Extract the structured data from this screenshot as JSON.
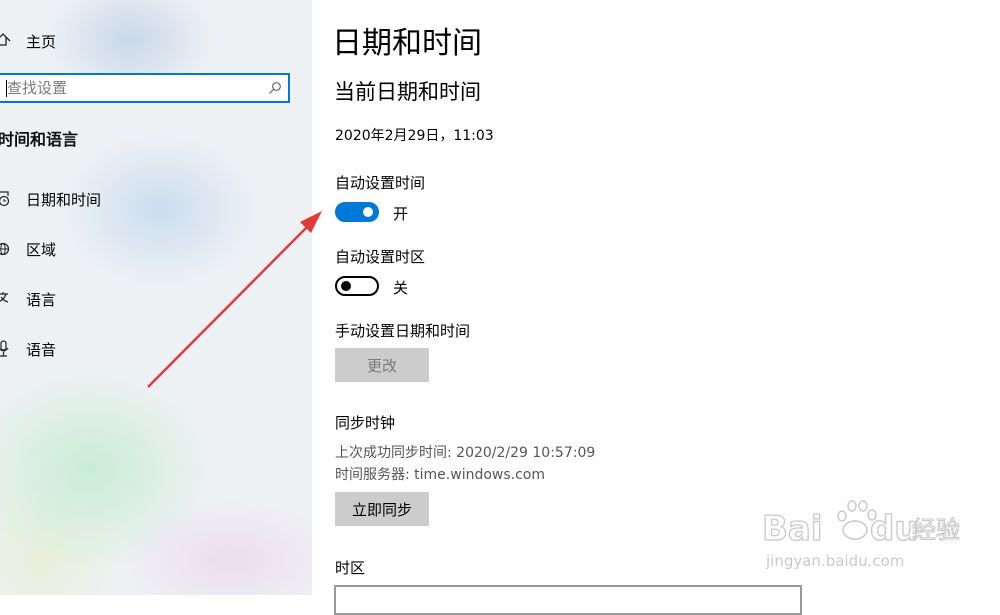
{
  "sidebar": {
    "home_label": "主页",
    "search_placeholder": "查找设置",
    "section_title": "时间和语言",
    "items": [
      {
        "label": "日期和时间",
        "icon": "date-time-icon"
      },
      {
        "label": "区域",
        "icon": "globe-icon"
      },
      {
        "label": "语言",
        "icon": "language-icon"
      },
      {
        "label": "语音",
        "icon": "microphone-icon"
      }
    ]
  },
  "main": {
    "title": "日期和时间",
    "subtitle": "当前日期和时间",
    "current_datetime": "2020年2月29日，11:03",
    "auto_time": {
      "label": "自动设置时间",
      "state": "开",
      "on": true
    },
    "auto_timezone": {
      "label": "自动设置时区",
      "state": "关",
      "on": false
    },
    "manual": {
      "label": "手动设置日期和时间",
      "button": "更改"
    },
    "sync": {
      "title": "同步时钟",
      "last_sync": "上次成功同步时间: 2020/2/29 10:57:09",
      "server": "时间服务器: time.windows.com",
      "button": "立即同步"
    },
    "timezone": {
      "label": "时区"
    }
  },
  "watermark": {
    "brand": "Baidu经验",
    "url": "jingyan.baidu.com"
  },
  "colors": {
    "accent": "#0078d7",
    "arrow": "#e23a3a"
  }
}
